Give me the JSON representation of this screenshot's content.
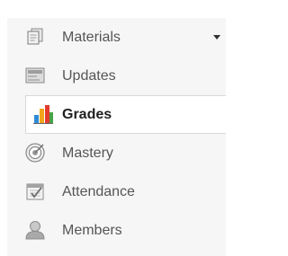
{
  "sidebar": {
    "items": [
      {
        "label": "Materials",
        "icon": "materials-icon",
        "has_dropdown": true
      },
      {
        "label": "Updates",
        "icon": "updates-icon"
      },
      {
        "label": "Grades",
        "icon": "grades-icon",
        "active": true
      },
      {
        "label": "Mastery",
        "icon": "mastery-icon"
      },
      {
        "label": "Attendance",
        "icon": "attendance-icon"
      },
      {
        "label": "Members",
        "icon": "members-icon"
      }
    ]
  },
  "colors": {
    "sidebar_bg": "#f6f6f6",
    "active_bg": "#ffffff",
    "text": "#555555",
    "active_text": "#1f1f1f"
  }
}
